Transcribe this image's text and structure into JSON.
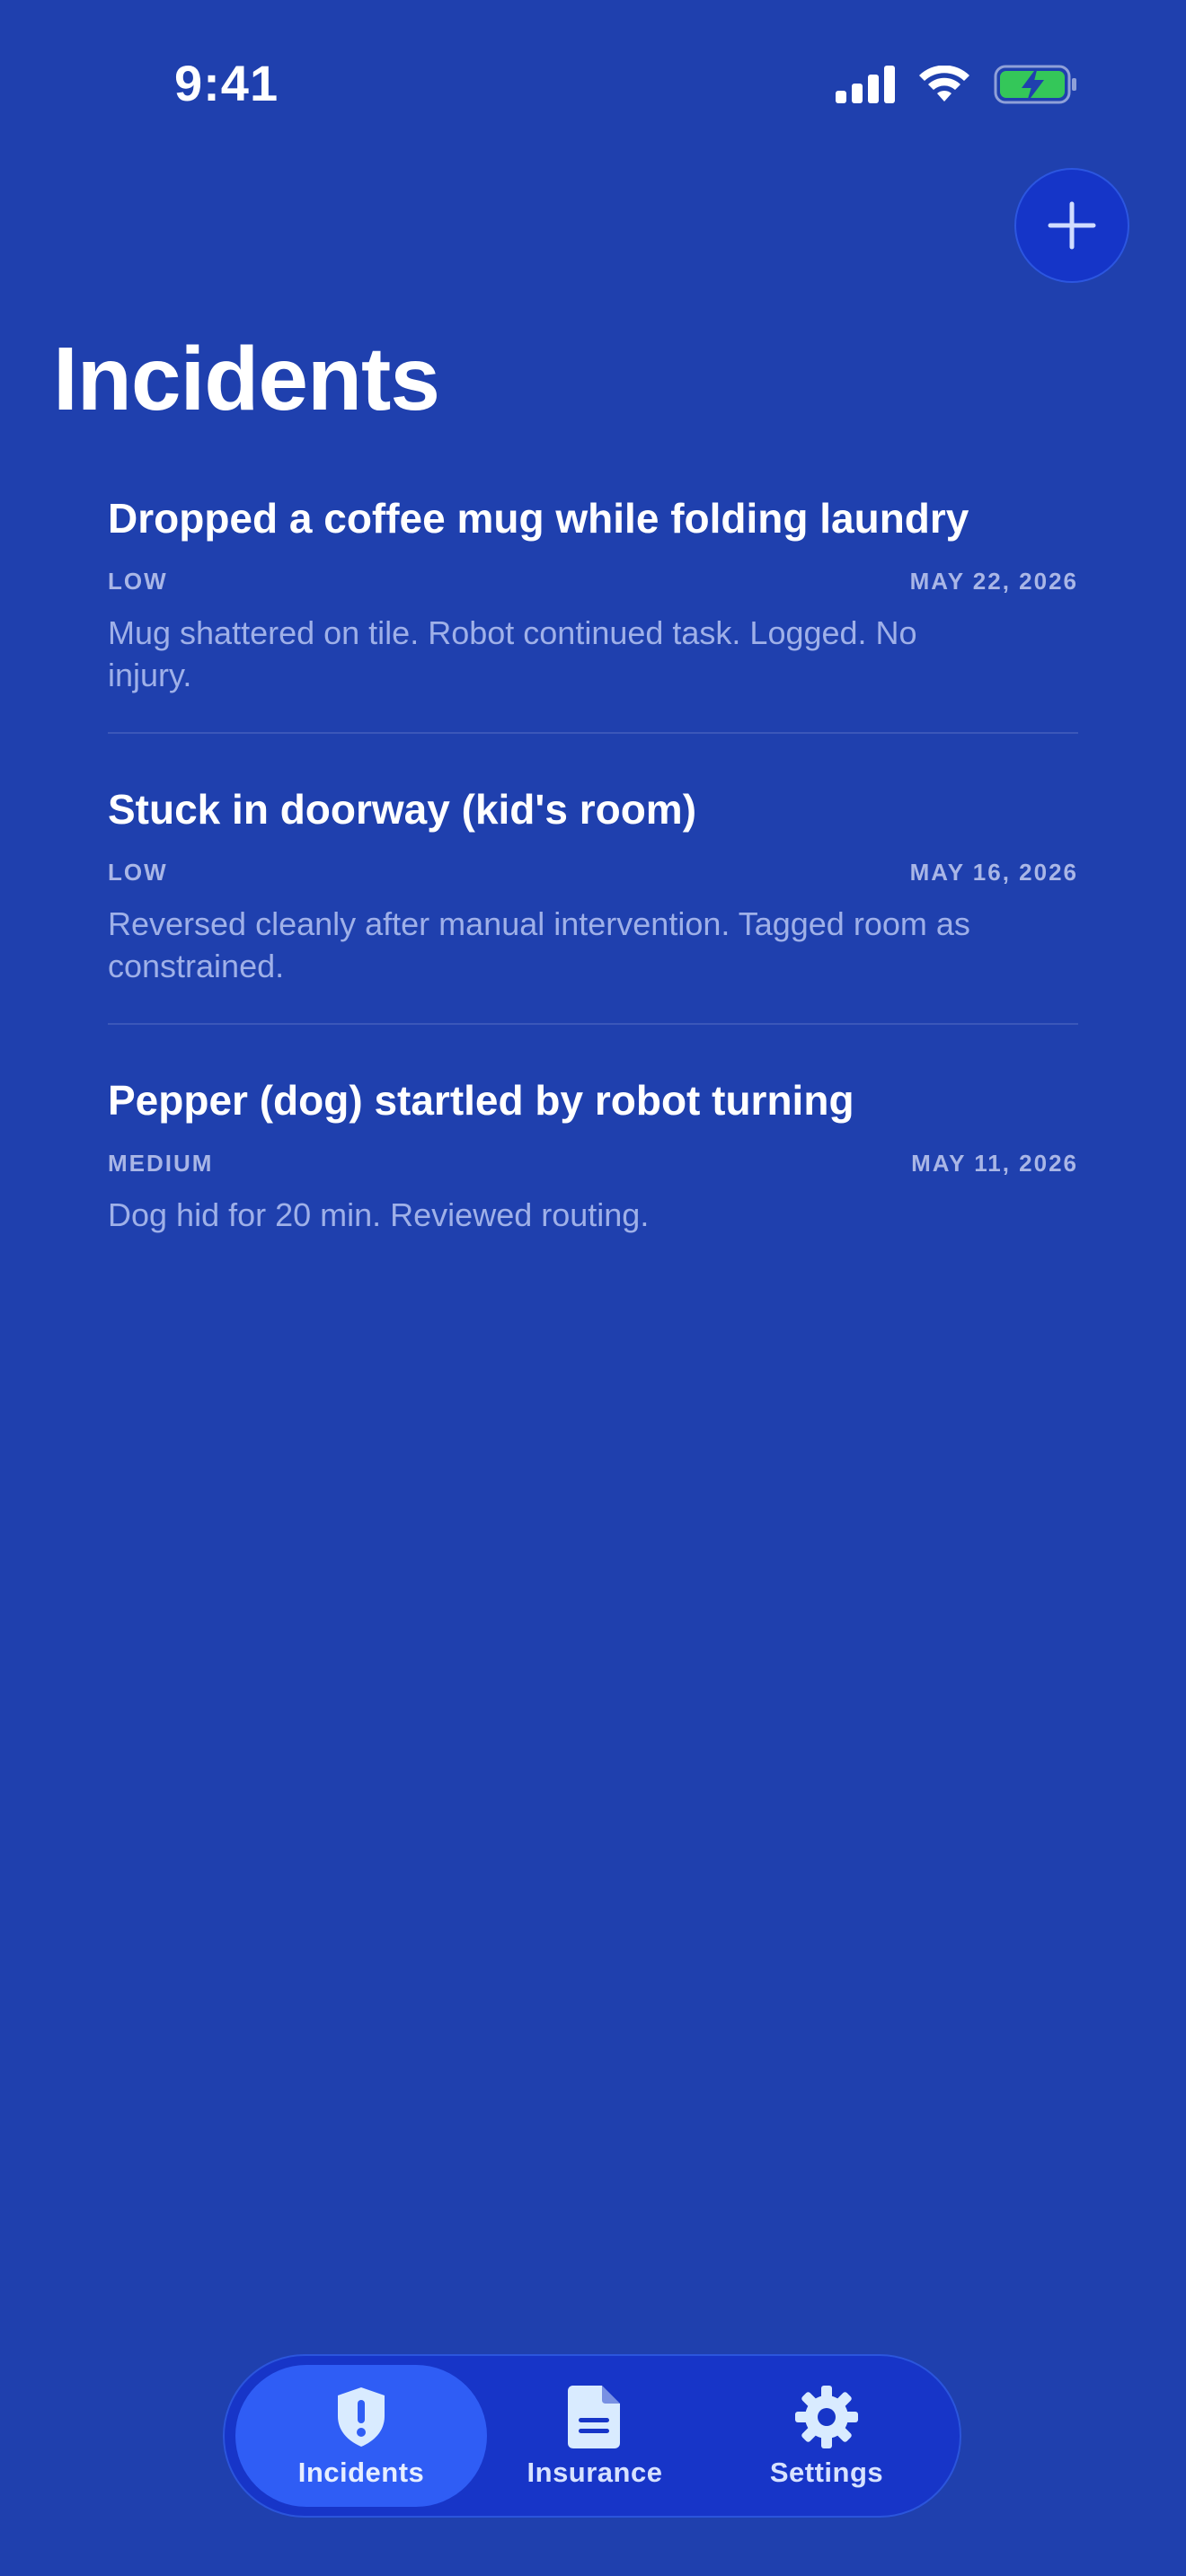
{
  "status_bar": {
    "time": "9:41"
  },
  "header": {
    "title": "Incidents",
    "add_button_icon": "plus-icon"
  },
  "incidents": [
    {
      "title": "Dropped a coffee mug while folding laundry",
      "severity": "LOW",
      "date": "MAY 22, 2026",
      "description": "Mug shattered on tile. Robot continued task. Logged. No injury."
    },
    {
      "title": "Stuck in doorway (kid's room)",
      "severity": "LOW",
      "date": "MAY 16, 2026",
      "description": "Reversed cleanly after manual intervention. Tagged room as constrained."
    },
    {
      "title": "Pepper (dog) startled by robot turning",
      "severity": "MEDIUM",
      "date": "MAY 11, 2026",
      "description": "Dog hid for 20 min. Reviewed routing."
    }
  ],
  "tab_bar": {
    "tabs": [
      {
        "label": "Incidents",
        "icon": "shield-exclamation-icon",
        "active": true
      },
      {
        "label": "Insurance",
        "icon": "document-icon",
        "active": false
      },
      {
        "label": "Settings",
        "icon": "gear-icon",
        "active": false
      }
    ]
  },
  "colors": {
    "background": "#1f40ae",
    "accent": "#2f5df5",
    "battery_fill": "#34c759"
  }
}
